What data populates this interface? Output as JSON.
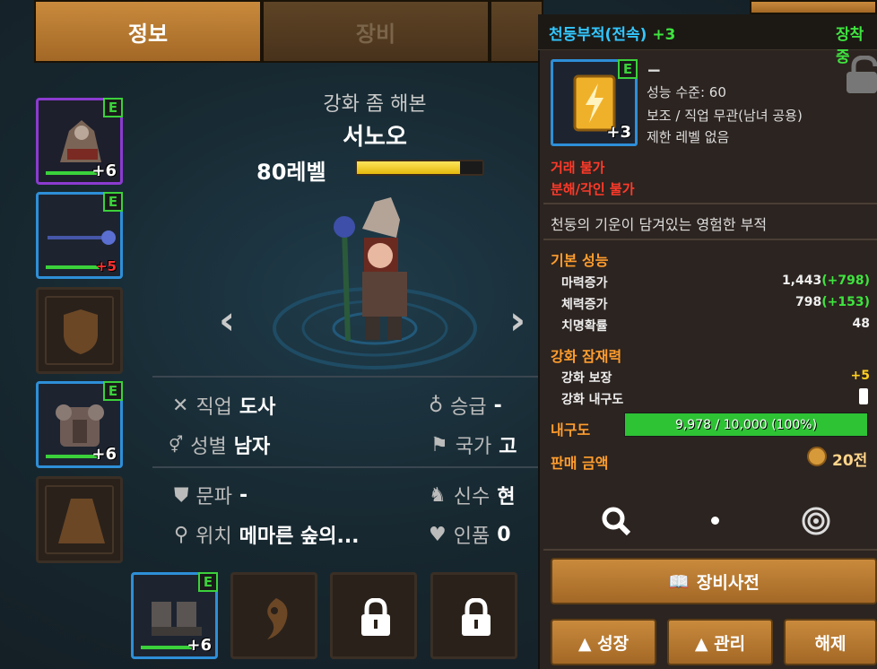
{
  "tabs": [
    {
      "label": "정보",
      "active": true
    },
    {
      "label": "장비",
      "active": false
    }
  ],
  "slots_left": [
    {
      "border": "purple",
      "badge": "E",
      "plus": "+6",
      "plus_color": "white",
      "icon": "helmet-icon"
    },
    {
      "border": "blue",
      "badge": "E",
      "plus": "+5",
      "plus_color": "red",
      "icon": "staff-icon"
    },
    {
      "border": "none",
      "badge": "",
      "plus": "",
      "icon": "shield-icon"
    },
    {
      "border": "blue",
      "badge": "E",
      "plus": "+6",
      "plus_color": "white",
      "icon": "armor-icon"
    },
    {
      "border": "none",
      "badge": "",
      "plus": "",
      "icon": "cape-icon"
    }
  ],
  "slots_bottom": [
    {
      "border": "blue",
      "badge": "E",
      "plus": "+6",
      "icon": "boots-icon"
    },
    {
      "border": "none",
      "icon": "yin-icon"
    },
    {
      "border": "none",
      "icon": "lock-icon"
    },
    {
      "border": "none",
      "icon": "lock-icon"
    }
  ],
  "character": {
    "title": "강화 좀 해본",
    "name": "서노오",
    "level": "80레벨",
    "xp_fraction": 0.82
  },
  "info": {
    "job_label": "직업",
    "job_value": "도사",
    "rank_label": "승급",
    "rank_value": "-",
    "gender_label": "성별",
    "gender_value": "남자",
    "nation_label": "국가",
    "nation_value": "고",
    "guild_label": "문파",
    "guild_value": "-",
    "guardian_label": "신수",
    "guardian_value": "현",
    "location_label": "위치",
    "location_value": "메마른 숲의...",
    "popularity_label": "인품",
    "popularity_value": "0"
  },
  "item": {
    "name": "천둥부적(전속)",
    "enhance": "+3",
    "equipped": "장착중",
    "badge": "E",
    "icon_plus": "+3",
    "dash": "−",
    "level_req": "성능 수준: 60",
    "type": "보조 / 직업 무관(남녀 공용)",
    "level_limit": "제한 레벨 없음",
    "no_trade": "거래 불가",
    "no_split": "분해/각인 불가",
    "description": "천둥의 기운이 담겨있는 영험한 부적",
    "base_header": "기본 성능",
    "stats": [
      {
        "name": "마력증가",
        "value": "1,443",
        "bonus": "(+798)"
      },
      {
        "name": "체력증가",
        "value": "798",
        "bonus": "(+153)"
      },
      {
        "name": "치명확률",
        "value": "48",
        "bonus": ""
      }
    ],
    "potential_header": "강화 잠재력",
    "guarantee_label": "강화 보장",
    "guarantee_value": "+5",
    "durability_enh_label": "강화 내구도",
    "durability_label": "내구도",
    "durability_text": "9,978 / 10,000 (100%)",
    "durability_fraction": 0.9978,
    "price_label": "판매 금액",
    "price_value": "20전"
  },
  "buttons": {
    "dictionary": "장비사전",
    "grow": "▲ 성장",
    "manage": "▲ 관리",
    "unequip": "해제"
  },
  "colors": {
    "accent_orange": "#c98a3c",
    "item_name_blue": "#32c7ff",
    "green": "#3fe43f",
    "red": "#ff3a2a",
    "section_orange": "#ff9d2e"
  }
}
